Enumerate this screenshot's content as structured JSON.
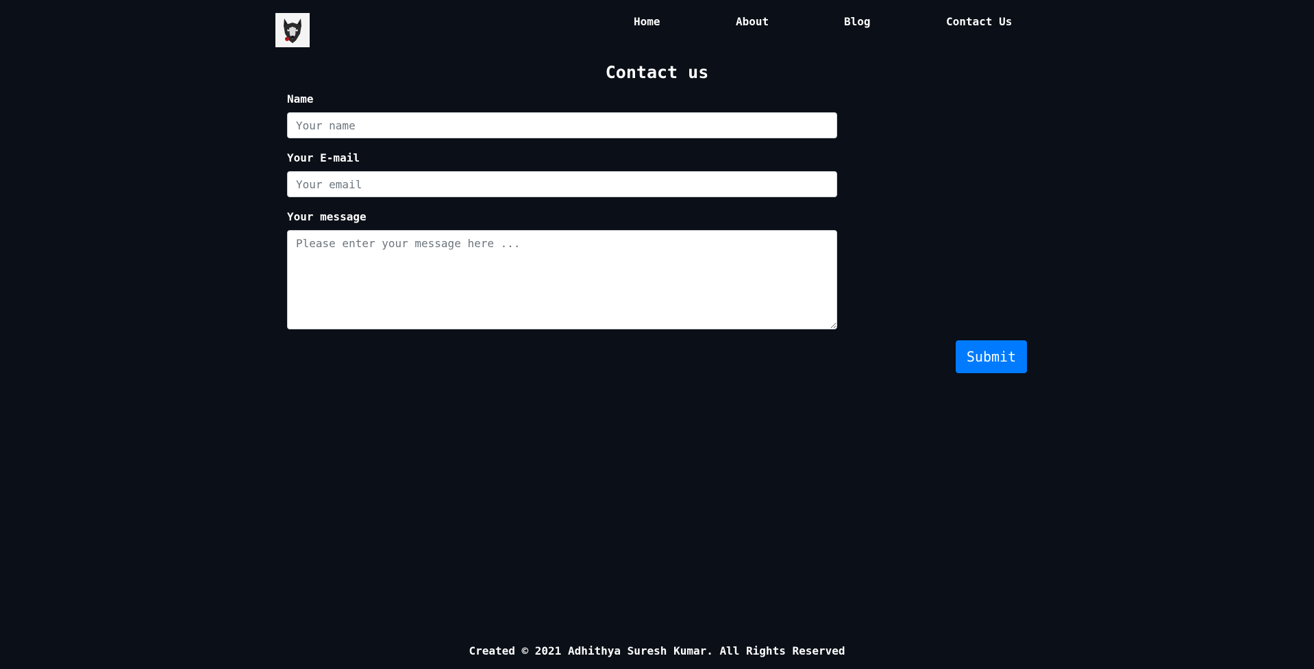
{
  "header": {
    "logo_icon": "wolf-logo-icon",
    "nav": {
      "home": "Home",
      "about": "About",
      "blog": "Blog",
      "contact": "Contact Us"
    }
  },
  "main": {
    "title": "Contact us",
    "form": {
      "name_label": "Name",
      "name_placeholder": "Your name",
      "email_label": "Your E-mail",
      "email_placeholder": "Your email",
      "message_label": "Your message",
      "message_placeholder": "Please enter your message here ...",
      "submit_label": "Submit"
    }
  },
  "footer": {
    "text": "Created © 2021 Adhithya Suresh Kumar. All Rights Reserved"
  },
  "colors": {
    "background": "#0b0f17",
    "accent": "#007bff",
    "text": "#ffffff"
  }
}
